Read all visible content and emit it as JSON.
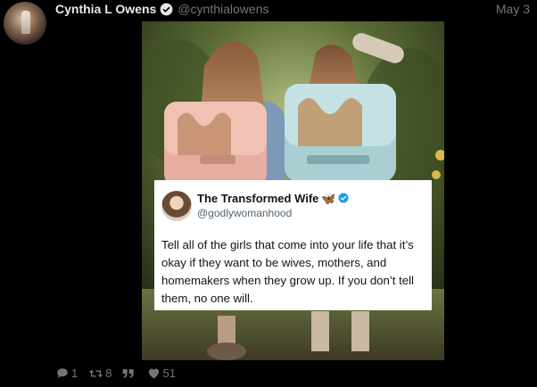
{
  "post": {
    "author_name": "Cynthia L Owens",
    "author_handle": "@cynthialowens",
    "date": "May 3",
    "verified_icon": "verified-badge-icon",
    "colors": {
      "background": "#000000",
      "text": "#e7e9ea",
      "muted": "#71767b",
      "verified": "#1d9bf0"
    }
  },
  "embedded_card": {
    "name": "The Transformed Wife",
    "name_emoji": "🦋",
    "handle": "@godlywomanhood",
    "text": "Tell all of the girls that come into your life that it’s okay if they want to be wives, mothers, and homemakers when they grow up. If you don’t tell them, no one will."
  },
  "actions": {
    "replies": "1",
    "retweets": "8",
    "quotes": "",
    "likes": "51"
  }
}
